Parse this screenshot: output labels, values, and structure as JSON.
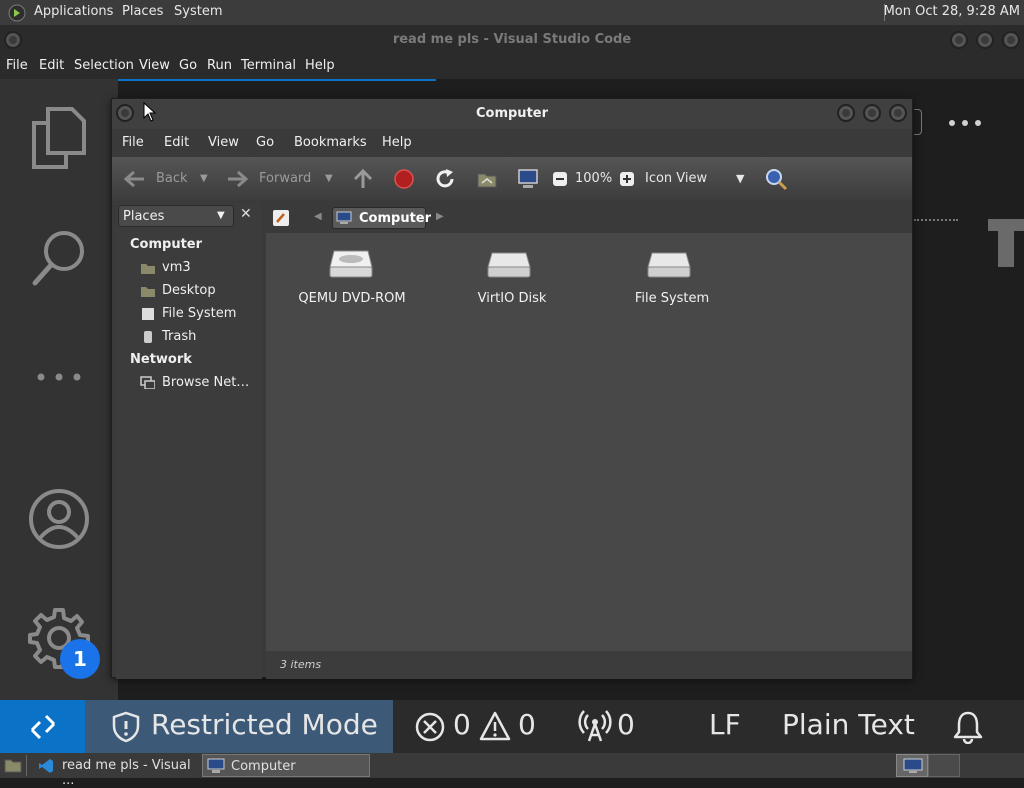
{
  "top_panel": {
    "menus": [
      "Applications",
      "Places",
      "System"
    ],
    "clock": "Mon Oct 28,  9:28 AM"
  },
  "vscode": {
    "title": "read me pls - Visual Studio Code",
    "menus": [
      "File",
      "Edit",
      "Selection",
      "View",
      "Go",
      "Run",
      "Terminal",
      "Help"
    ],
    "badge_count": "1",
    "status": {
      "restricted": "Restricted Mode",
      "errors": "0",
      "warnings": "0",
      "ports": "0",
      "eol": "LF",
      "language": "Plain Text"
    }
  },
  "file_manager": {
    "title": "Computer",
    "menus": [
      "File",
      "Edit",
      "View",
      "Go",
      "Bookmarks",
      "Help"
    ],
    "toolbar": {
      "back": "Back",
      "forward": "Forward",
      "zoom": "100%",
      "view_mode": "Icon View"
    },
    "sidebar": {
      "selector": "Places",
      "sections": [
        {
          "heading": "Computer",
          "items": [
            "vm3",
            "Desktop",
            "File System",
            "Trash"
          ]
        },
        {
          "heading": "Network",
          "items": [
            "Browse Net…"
          ]
        }
      ]
    },
    "location": "Computer",
    "items": [
      "QEMU DVD-ROM",
      "VirtIO Disk",
      "File System"
    ],
    "status": "3 items"
  },
  "taskbar": {
    "tasks": [
      "read me pls - Visual ...",
      "Computer"
    ]
  },
  "colors": {
    "accent_blue": "#0a73c8",
    "restricted_bg": "#3c5a78",
    "badge_blue": "#1a73e8"
  }
}
